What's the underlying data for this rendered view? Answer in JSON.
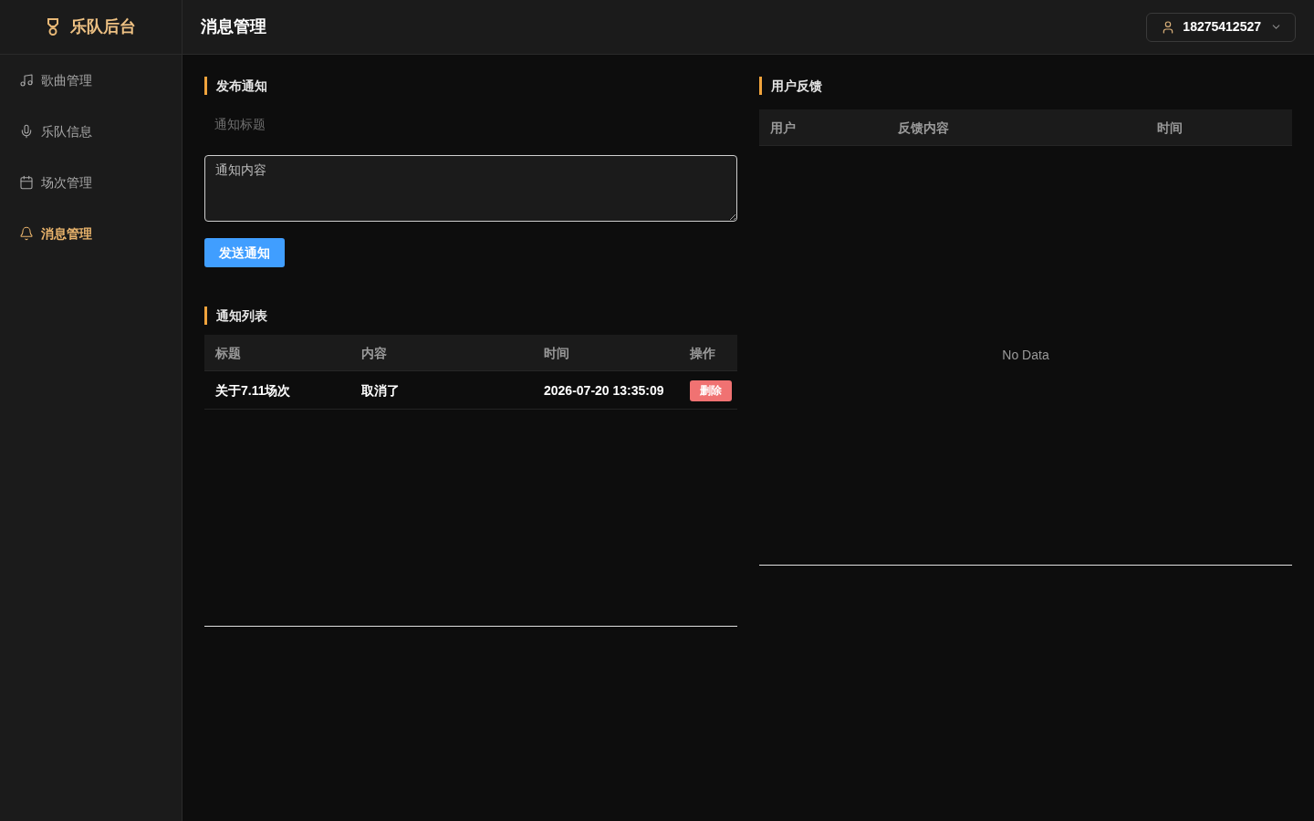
{
  "sidebar": {
    "logo": {
      "title": "乐队后台"
    },
    "items": [
      {
        "label": "歌曲管理",
        "selected": false
      },
      {
        "label": "乐队信息",
        "selected": false
      },
      {
        "label": "场次管理",
        "selected": false
      },
      {
        "label": "消息管理",
        "selected": true
      }
    ]
  },
  "header": {
    "title": "消息管理",
    "user": {
      "phone": "18275412527"
    }
  },
  "publish_notice": {
    "title": "发布通知",
    "title_field": {
      "placeholder": "通知标题"
    },
    "content_field": {
      "placeholder": "通知内容"
    },
    "submit_button": "发送通知"
  },
  "notice_list": {
    "title": "通知列表",
    "columns": [
      "标题",
      "内容",
      "时间",
      "操作"
    ],
    "rows": [
      {
        "title": "关于7.11场次",
        "content": "取消了",
        "time": "2026-07-20 13:35:09",
        "action": "删除"
      }
    ]
  },
  "feedback": {
    "title": "用户反馈",
    "columns": [
      "用户",
      "反馈内容",
      "时间"
    ],
    "empty_text": "No Data"
  }
}
